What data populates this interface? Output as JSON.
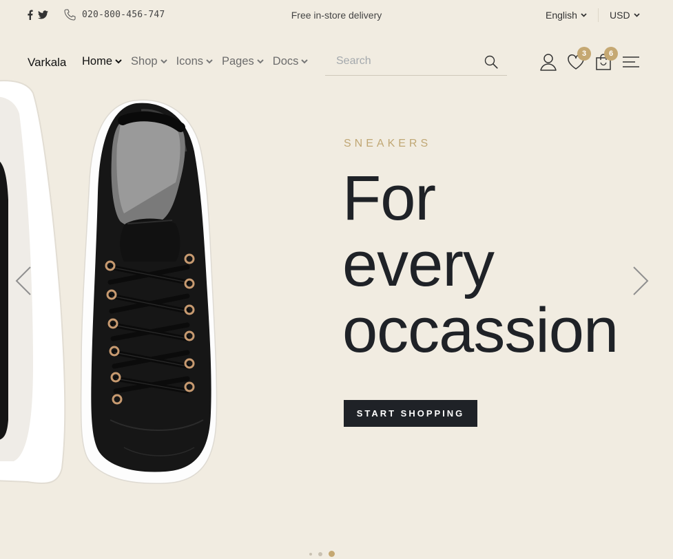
{
  "topbar": {
    "social": [
      "facebook-icon",
      "twitter-icon"
    ],
    "phone": "020-800-456-747",
    "promo": "Free in-store delivery",
    "language": "English",
    "currency": "USD"
  },
  "navbar": {
    "brand": "Varkala",
    "menu": [
      {
        "label": "Home",
        "active": true
      },
      {
        "label": "Shop",
        "active": false
      },
      {
        "label": "Icons",
        "active": false
      },
      {
        "label": "Pages",
        "active": false
      },
      {
        "label": "Docs",
        "active": false
      }
    ],
    "search_placeholder": "Search",
    "wishlist_count": "3",
    "cart_count": "6"
  },
  "hero": {
    "eyebrow": "SNEAKERS",
    "headline": [
      "For",
      "every",
      "occassion"
    ],
    "cta": "START SHOPPING",
    "slides": 3,
    "active_slide": 3
  },
  "colors": {
    "background": "#f1ece1",
    "accent": "#c5a872",
    "dark": "#1f2227"
  }
}
